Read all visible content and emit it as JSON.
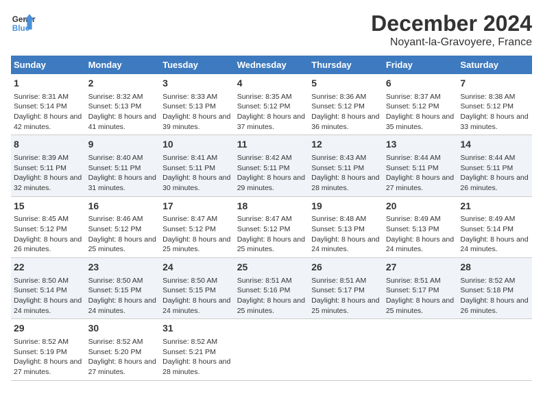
{
  "header": {
    "logo_line1": "General",
    "logo_line2": "Blue",
    "month": "December 2024",
    "location": "Noyant-la-Gravoyere, France"
  },
  "weekdays": [
    "Sunday",
    "Monday",
    "Tuesday",
    "Wednesday",
    "Thursday",
    "Friday",
    "Saturday"
  ],
  "weeks": [
    [
      {
        "day": "1",
        "sunrise": "Sunrise: 8:31 AM",
        "sunset": "Sunset: 5:14 PM",
        "daylight": "Daylight: 8 hours and 42 minutes."
      },
      {
        "day": "2",
        "sunrise": "Sunrise: 8:32 AM",
        "sunset": "Sunset: 5:13 PM",
        "daylight": "Daylight: 8 hours and 41 minutes."
      },
      {
        "day": "3",
        "sunrise": "Sunrise: 8:33 AM",
        "sunset": "Sunset: 5:13 PM",
        "daylight": "Daylight: 8 hours and 39 minutes."
      },
      {
        "day": "4",
        "sunrise": "Sunrise: 8:35 AM",
        "sunset": "Sunset: 5:12 PM",
        "daylight": "Daylight: 8 hours and 37 minutes."
      },
      {
        "day": "5",
        "sunrise": "Sunrise: 8:36 AM",
        "sunset": "Sunset: 5:12 PM",
        "daylight": "Daylight: 8 hours and 36 minutes."
      },
      {
        "day": "6",
        "sunrise": "Sunrise: 8:37 AM",
        "sunset": "Sunset: 5:12 PM",
        "daylight": "Daylight: 8 hours and 35 minutes."
      },
      {
        "day": "7",
        "sunrise": "Sunrise: 8:38 AM",
        "sunset": "Sunset: 5:12 PM",
        "daylight": "Daylight: 8 hours and 33 minutes."
      }
    ],
    [
      {
        "day": "8",
        "sunrise": "Sunrise: 8:39 AM",
        "sunset": "Sunset: 5:11 PM",
        "daylight": "Daylight: 8 hours and 32 minutes."
      },
      {
        "day": "9",
        "sunrise": "Sunrise: 8:40 AM",
        "sunset": "Sunset: 5:11 PM",
        "daylight": "Daylight: 8 hours and 31 minutes."
      },
      {
        "day": "10",
        "sunrise": "Sunrise: 8:41 AM",
        "sunset": "Sunset: 5:11 PM",
        "daylight": "Daylight: 8 hours and 30 minutes."
      },
      {
        "day": "11",
        "sunrise": "Sunrise: 8:42 AM",
        "sunset": "Sunset: 5:11 PM",
        "daylight": "Daylight: 8 hours and 29 minutes."
      },
      {
        "day": "12",
        "sunrise": "Sunrise: 8:43 AM",
        "sunset": "Sunset: 5:11 PM",
        "daylight": "Daylight: 8 hours and 28 minutes."
      },
      {
        "day": "13",
        "sunrise": "Sunrise: 8:44 AM",
        "sunset": "Sunset: 5:11 PM",
        "daylight": "Daylight: 8 hours and 27 minutes."
      },
      {
        "day": "14",
        "sunrise": "Sunrise: 8:44 AM",
        "sunset": "Sunset: 5:11 PM",
        "daylight": "Daylight: 8 hours and 26 minutes."
      }
    ],
    [
      {
        "day": "15",
        "sunrise": "Sunrise: 8:45 AM",
        "sunset": "Sunset: 5:12 PM",
        "daylight": "Daylight: 8 hours and 26 minutes."
      },
      {
        "day": "16",
        "sunrise": "Sunrise: 8:46 AM",
        "sunset": "Sunset: 5:12 PM",
        "daylight": "Daylight: 8 hours and 25 minutes."
      },
      {
        "day": "17",
        "sunrise": "Sunrise: 8:47 AM",
        "sunset": "Sunset: 5:12 PM",
        "daylight": "Daylight: 8 hours and 25 minutes."
      },
      {
        "day": "18",
        "sunrise": "Sunrise: 8:47 AM",
        "sunset": "Sunset: 5:12 PM",
        "daylight": "Daylight: 8 hours and 25 minutes."
      },
      {
        "day": "19",
        "sunrise": "Sunrise: 8:48 AM",
        "sunset": "Sunset: 5:13 PM",
        "daylight": "Daylight: 8 hours and 24 minutes."
      },
      {
        "day": "20",
        "sunrise": "Sunrise: 8:49 AM",
        "sunset": "Sunset: 5:13 PM",
        "daylight": "Daylight: 8 hours and 24 minutes."
      },
      {
        "day": "21",
        "sunrise": "Sunrise: 8:49 AM",
        "sunset": "Sunset: 5:14 PM",
        "daylight": "Daylight: 8 hours and 24 minutes."
      }
    ],
    [
      {
        "day": "22",
        "sunrise": "Sunrise: 8:50 AM",
        "sunset": "Sunset: 5:14 PM",
        "daylight": "Daylight: 8 hours and 24 minutes."
      },
      {
        "day": "23",
        "sunrise": "Sunrise: 8:50 AM",
        "sunset": "Sunset: 5:15 PM",
        "daylight": "Daylight: 8 hours and 24 minutes."
      },
      {
        "day": "24",
        "sunrise": "Sunrise: 8:50 AM",
        "sunset": "Sunset: 5:15 PM",
        "daylight": "Daylight: 8 hours and 24 minutes."
      },
      {
        "day": "25",
        "sunrise": "Sunrise: 8:51 AM",
        "sunset": "Sunset: 5:16 PM",
        "daylight": "Daylight: 8 hours and 25 minutes."
      },
      {
        "day": "26",
        "sunrise": "Sunrise: 8:51 AM",
        "sunset": "Sunset: 5:17 PM",
        "daylight": "Daylight: 8 hours and 25 minutes."
      },
      {
        "day": "27",
        "sunrise": "Sunrise: 8:51 AM",
        "sunset": "Sunset: 5:17 PM",
        "daylight": "Daylight: 8 hours and 25 minutes."
      },
      {
        "day": "28",
        "sunrise": "Sunrise: 8:52 AM",
        "sunset": "Sunset: 5:18 PM",
        "daylight": "Daylight: 8 hours and 26 minutes."
      }
    ],
    [
      {
        "day": "29",
        "sunrise": "Sunrise: 8:52 AM",
        "sunset": "Sunset: 5:19 PM",
        "daylight": "Daylight: 8 hours and 27 minutes."
      },
      {
        "day": "30",
        "sunrise": "Sunrise: 8:52 AM",
        "sunset": "Sunset: 5:20 PM",
        "daylight": "Daylight: 8 hours and 27 minutes."
      },
      {
        "day": "31",
        "sunrise": "Sunrise: 8:52 AM",
        "sunset": "Sunset: 5:21 PM",
        "daylight": "Daylight: 8 hours and 28 minutes."
      },
      null,
      null,
      null,
      null
    ]
  ]
}
